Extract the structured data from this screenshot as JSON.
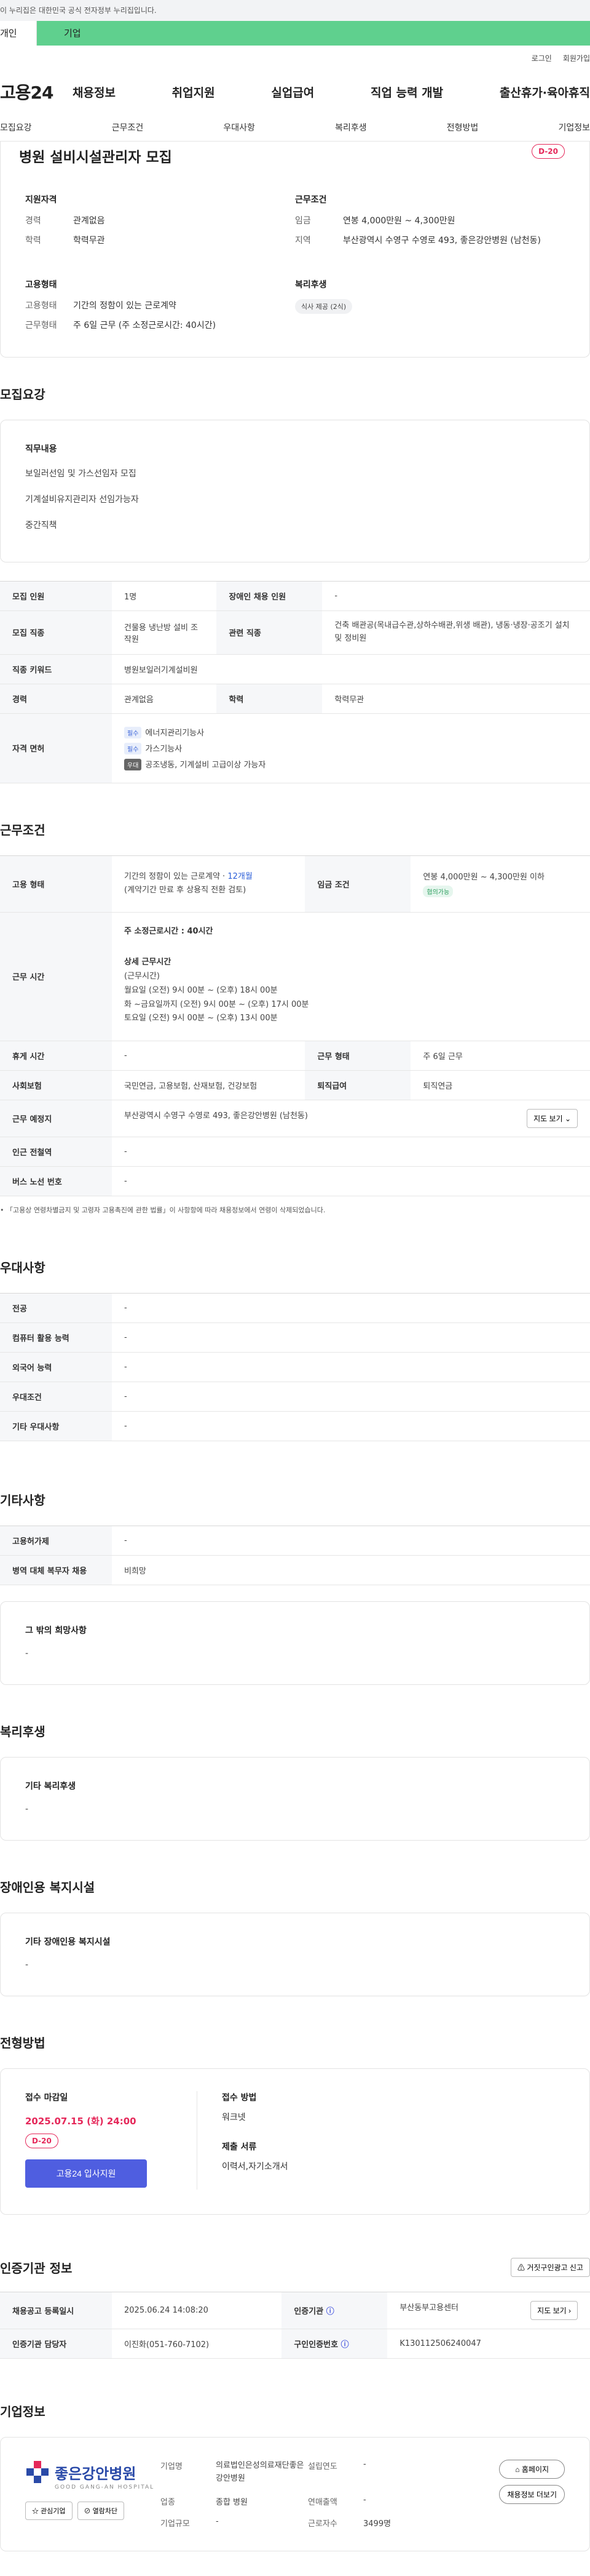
{
  "gov_banner": "이 누리집은 대한민국 공식 전자정부 누리집입니다.",
  "top_tabs": {
    "individual": "개인",
    "corporate": "기업"
  },
  "util": {
    "login": "로그인",
    "signup": "회원가입"
  },
  "logo": "고용24",
  "gnb": [
    "채용정보",
    "취업지원",
    "실업급여",
    "직업 능력 개발",
    "출산휴가·육아휴직"
  ],
  "subnav": [
    "모집요강",
    "근무조건",
    "우대사항",
    "복리후생",
    "전형방법",
    "기업정보"
  ],
  "title": "병원 설비시설관리자 모집",
  "dday": "D-20",
  "summary": {
    "qual_title": "지원자격",
    "qual": [
      {
        "k": "경력",
        "v": "관계없음"
      },
      {
        "k": "학력",
        "v": "학력무관"
      }
    ],
    "cond_title": "근무조건",
    "cond": [
      {
        "k": "임금",
        "v": "연봉 4,000만원 ~ 4,300만원"
      },
      {
        "k": "지역",
        "v": "부산광역시 수영구 수영로 493, 좋은강안병원 (남천동)"
      }
    ],
    "emp_title": "고용형태",
    "emp": [
      {
        "k": "고용형태",
        "v": "기간의 정함이 있는 근로계약"
      },
      {
        "k": "근무형태",
        "v": "주 6일 근무 (주 소정근로시간: 40시간)"
      }
    ],
    "welfare_title": "복리후생",
    "welfare_chip": "식사 제공 (2식)"
  },
  "recruit": {
    "section": "모집요강",
    "job_title": "직무내용",
    "jobs": [
      "보일러선임 및 가스선임자 모집",
      "기계설비유지관리자 선임가능자",
      "중간직책"
    ],
    "table": {
      "count_k": "모집 인원",
      "count_v": "1명",
      "disabled_k": "장애인 채용 인원",
      "disabled_v": "-",
      "job_k": "모집 직종",
      "job_v": "건물용 냉난방 설비 조작원",
      "rel_k": "관련 직종",
      "rel_v": "건축 배관공(목내급수관,상하수배관,위생 배관), 냉동·냉장·공조기 설치 및 정비원",
      "kw_k": "직종 키워드",
      "kw_v": "병원보일러기계설비원",
      "career_k": "경력",
      "career_v": "관계없음",
      "edu_k": "학력",
      "edu_v": "학력무관",
      "lic_k": "자격 면허",
      "licenses": [
        {
          "tag": "필수",
          "name": "에너지관리기능사"
        },
        {
          "tag": "필수",
          "name": "가스기능사"
        },
        {
          "tag": "우대",
          "name": "공조냉동, 기계설비 고급이상 가능자"
        }
      ]
    }
  },
  "work": {
    "section": "근무조건",
    "type_k": "고용 형태",
    "type_v1": "기간의 정함이 있는 근로계약 · ",
    "type_months": "12개월",
    "type_v2": "(계약기간 만료 후 상용직 전환 검토)",
    "wage_k": "임금 조건",
    "wage_v": "연봉 4,000만원 ~ 4,300만원 이하",
    "wage_chip": "협의가능",
    "hours_k": "근무 시간",
    "hours_main": "주 소정근로시간 : 40시간",
    "hours_detail_title": "상세 근무시간",
    "hours_lines": [
      "(근무시간)",
      "월요일 (오전) 9시 00분 ~ (오후) 18시 00분",
      "화 ~금요일까지   (오전) 9시 00분 ~ (오후) 17시 00분",
      "토요일  (오전) 9시 00분 ~ (오후) 13시 00분"
    ],
    "rest_k": "휴게 시간",
    "rest_v": "-",
    "form_k": "근무 형태",
    "form_v": "주 6일 근무",
    "ins_k": "사회보험",
    "ins_v": "국민연금, 고용보험, 산재보험, 건강보험",
    "sev_k": "퇴직급여",
    "sev_v": "퇴직연금",
    "place_k": "근무 예정지",
    "place_v": "부산광역시 수영구 수영로 493, 좋은강안병원 (남천동)",
    "map_btn": "지도 보기",
    "subway_k": "인근 전철역",
    "subway_v": "-",
    "bus_k": "버스 노선 번호",
    "bus_v": "-",
    "note": "「고용상 연령차별금지 및 고령자 고용촉진에 관한 법률」이 사항항에 따라 채용정보에서 연령이 삭제되었습니다."
  },
  "pref": {
    "section": "우대사항",
    "rows": [
      {
        "k": "전공",
        "v": "-"
      },
      {
        "k": "컴퓨터 활용 능력",
        "v": "-"
      },
      {
        "k": "외국어 능력",
        "v": "-"
      },
      {
        "k": "우대조건",
        "v": "-"
      },
      {
        "k": "기타 우대사항",
        "v": "-"
      }
    ]
  },
  "other": {
    "section": "기타사항",
    "rows": [
      {
        "k": "고용허가제",
        "v": "-"
      },
      {
        "k": "병역 대체 복무자 채용",
        "v": "비희망"
      }
    ],
    "hope_title": "그 밖의 희망사항",
    "hope_v": "-"
  },
  "welfare": {
    "section": "복리후생",
    "title": "기타 복리후생",
    "v": "-"
  },
  "disability": {
    "section": "장애인용 복지시설",
    "title": "기타 장애인용 복지시설",
    "v": "-"
  },
  "apply": {
    "section": "전형방법",
    "deadline_title": "접수 마감일",
    "deadline": "2025.07.15 (화) 24:00",
    "dday": "D-20",
    "button": "고용24 입사지원",
    "method_title": "접수 방법",
    "method_v": "워크넷",
    "docs_title": "제출 서류",
    "docs_v": "이력서,자기소개서"
  },
  "auth": {
    "section": "인증기관 정보",
    "report_btn": "거짓구인광고 신고",
    "reg_k": "채용공고 등록일시",
    "reg_v": "2025.06.24 14:08:20",
    "org_k": "인증기관",
    "org_v": "부산동부고용센터",
    "map_btn": "지도 보기",
    "mgr_k": "인증기관 담당자",
    "mgr_v": "이진화(051-760-7102)",
    "num_k": "구인인증번호",
    "num_v": "K130112506240047"
  },
  "company": {
    "section": "기업정보",
    "logo_name": "좋은강안병원",
    "logo_sub": "GOOD GANG-AN HOSPITAL",
    "fav_btn": "관심기업",
    "block_btn": "열람차단",
    "name_k": "기업명",
    "name_v": "의료법인은성의료재단좋은강안병원",
    "year_k": "설립연도",
    "year_v": "-",
    "ind_k": "업종",
    "ind_v": "종합 병원",
    "sales_k": "연매출액",
    "sales_v": "-",
    "size_k": "기업규모",
    "size_v": "-",
    "emp_k": "근로자수",
    "emp_v": "3499명",
    "home_btn": "홈페이지",
    "list_btn": "채용정보 더보기"
  }
}
